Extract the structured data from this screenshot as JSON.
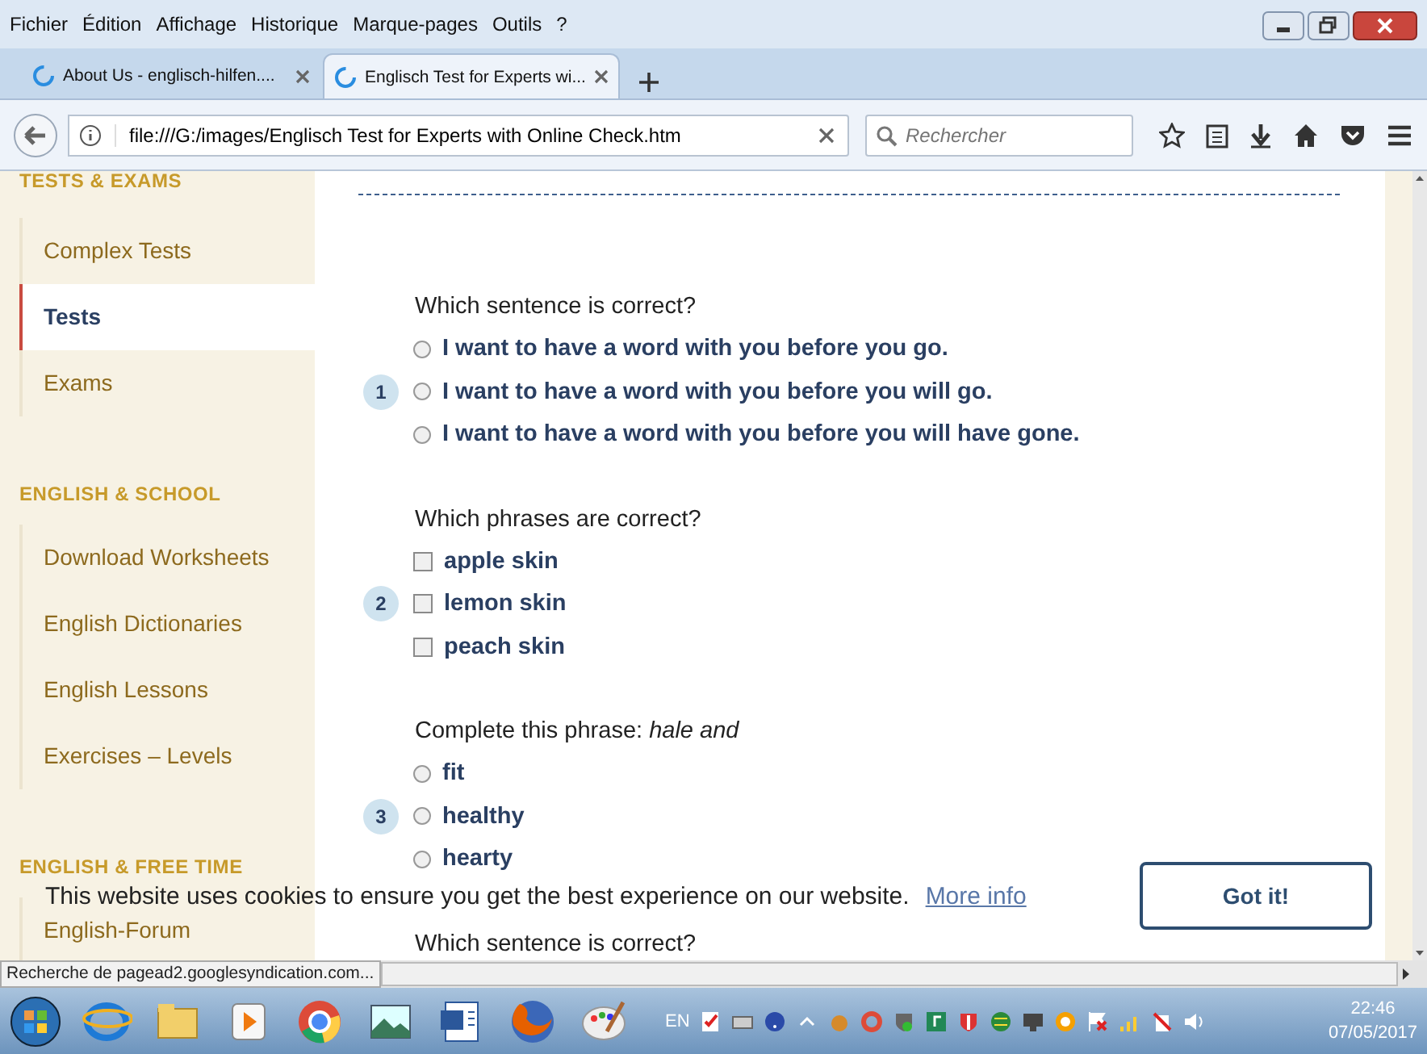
{
  "menu": [
    "Fichier",
    "Édition",
    "Affichage",
    "Historique",
    "Marque-pages",
    "Outils",
    "?"
  ],
  "tabs": [
    {
      "title": "About Us - englisch-hilfen....",
      "selected": false
    },
    {
      "title": "Englisch Test for Experts wi...",
      "selected": true
    }
  ],
  "address": {
    "value": "file:///G:/images/Englisch Test for Experts with Online Check.htm"
  },
  "search": {
    "placeholder": "Rechercher"
  },
  "sidebar": {
    "sections": [
      {
        "heading": "TESTS & EXAMS",
        "items": [
          {
            "label": "Complex Tests",
            "selected": false
          },
          {
            "label": "Tests",
            "selected": true
          },
          {
            "label": "Exams",
            "selected": false
          }
        ]
      },
      {
        "heading": "ENGLISH & SCHOOL",
        "items": [
          {
            "label": "Download Worksheets",
            "selected": false
          },
          {
            "label": "English Dictionaries",
            "selected": false
          },
          {
            "label": "English Lessons",
            "selected": false
          },
          {
            "label": "Exercises – Levels",
            "selected": false
          }
        ]
      },
      {
        "heading": "ENGLISH & FREE TIME",
        "items": [
          {
            "label": "English-Forum",
            "selected": false
          }
        ]
      }
    ]
  },
  "questions": [
    {
      "number": "1",
      "prompt": "Which sentence is correct?",
      "options": [
        {
          "kind": "radio",
          "text": "I want to have a word with you before you go.",
          "checked": false
        },
        {
          "kind": "radio",
          "text": "I want to have a word with you before you will go.",
          "checked": false
        },
        {
          "kind": "radio",
          "text": "I want to have a word with you before you will have gone.",
          "checked": false
        }
      ]
    },
    {
      "number": "2",
      "prompt": "Which phrases are correct?",
      "options": [
        {
          "kind": "checkbox",
          "text": "apple skin",
          "checked": false
        },
        {
          "kind": "checkbox",
          "text": "lemon skin",
          "checked": false
        },
        {
          "kind": "checkbox",
          "text": "peach skin",
          "checked": false
        }
      ]
    },
    {
      "number": "3",
      "prompt": "Complete this phrase: *hale and*",
      "options": [
        {
          "kind": "radio",
          "text": "fit",
          "checked": false
        },
        {
          "kind": "radio",
          "text": "healthy",
          "checked": false
        },
        {
          "kind": "radio",
          "text": "hearty",
          "checked": false
        }
      ]
    },
    {
      "prompt": "Which sentence is correct?"
    }
  ],
  "cookie_banner": {
    "text": "This website uses cookies to ensure you get the best experience on our website.",
    "link": "More info",
    "button": "Got it!"
  },
  "status_bar": {
    "text": "Recherche de pagead2.googlesyndication.com..."
  },
  "taskbar": {
    "language": "EN",
    "time": "22:46",
    "date": "07/05/2017"
  }
}
